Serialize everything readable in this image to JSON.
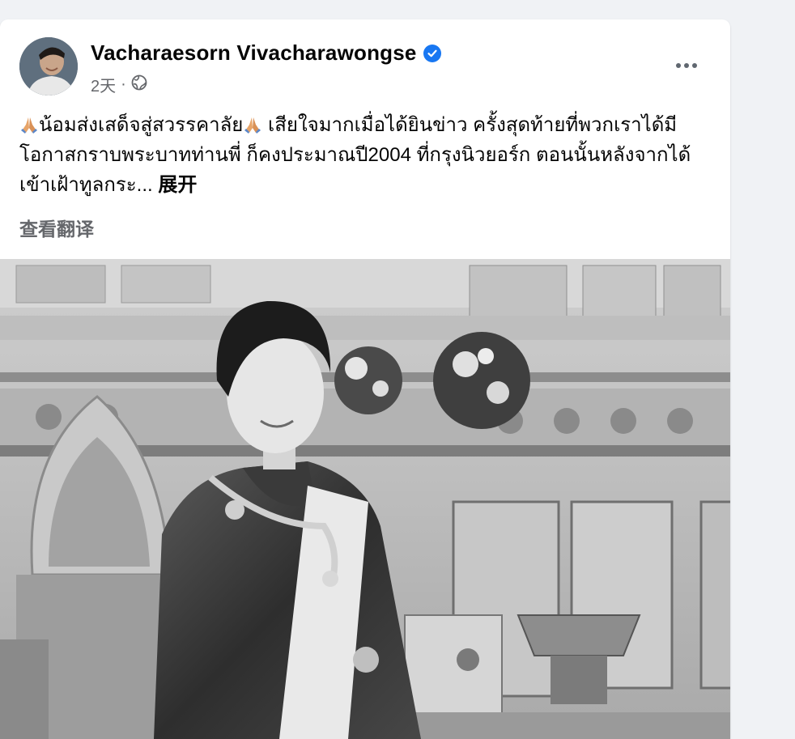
{
  "post": {
    "author": "Vacharaesorn Vivacharawongse",
    "verified": true,
    "time": "2天",
    "separator": "·",
    "audience_icon": "globe-icon",
    "body_part1": "น้อมส่งเสด็จสู่สวรรคาลัย",
    "body_part2": " เสียใจมากเมื่อได้ยินข่าว ครั้งสุดท้ายที่พวกเราได้มีโอกาสกราบพระบาทท่านพี่ ก็คงประมาณปี2004 ที่กรุงนิวยอร์ก ตอนนั้นหลังจากได้เข้าเฝ้าทูลกระ...",
    "expand_label": " 展开",
    "translate_label": "查看翻译",
    "emoji_icon": "folded-hands-emoji",
    "photo_icon": "portrait-photo"
  },
  "colors": {
    "page_bg": "#f0f2f5",
    "card_bg": "#ffffff",
    "text_primary": "#050505",
    "text_secondary": "#65676b",
    "verified_blue": "#1877f2"
  }
}
